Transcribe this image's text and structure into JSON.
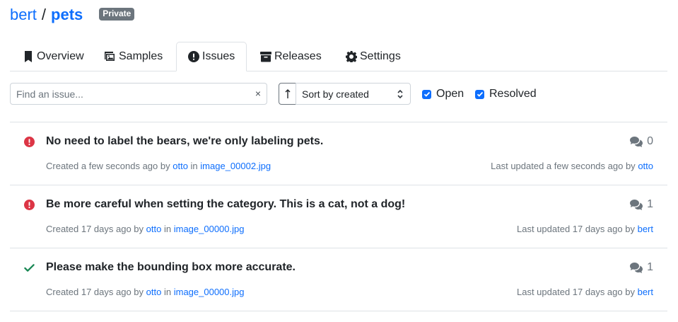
{
  "header": {
    "owner": "bert",
    "separator": "/",
    "repo": "pets",
    "visibility_badge": "Private"
  },
  "tabs": [
    {
      "label": "Overview",
      "icon": "bookmark-icon",
      "active": false
    },
    {
      "label": "Samples",
      "icon": "images-icon",
      "active": false
    },
    {
      "label": "Issues",
      "icon": "exclamation-circle-icon",
      "active": true
    },
    {
      "label": "Releases",
      "icon": "archive-icon",
      "active": false
    },
    {
      "label": "Settings",
      "icon": "gear-icon",
      "active": false
    }
  ],
  "filters": {
    "search_placeholder": "Find an issue...",
    "search_value": "",
    "clear": "×",
    "sort_label": "Sort by created",
    "open_label": "Open",
    "open_checked": true,
    "resolved_label": "Resolved",
    "resolved_checked": true
  },
  "issues": [
    {
      "status": "open",
      "title": "No need to label the bears, we're only labeling pets.",
      "comments": "0",
      "created_prefix": "Created a few seconds ago by",
      "author": "otto",
      "in": "in",
      "file": "image_00002.jpg",
      "updated_prefix": "Last updated a few seconds ago by",
      "updated_by": "otto"
    },
    {
      "status": "open",
      "title": "Be more careful when setting the category. This is a cat, not a dog!",
      "comments": "1",
      "created_prefix": "Created 17 days ago by",
      "author": "otto",
      "in": "in",
      "file": "image_00000.jpg",
      "updated_prefix": "Last updated 17 days ago by",
      "updated_by": "bert"
    },
    {
      "status": "resolved",
      "title": "Please make the bounding box more accurate.",
      "comments": "1",
      "created_prefix": "Created 17 days ago by",
      "author": "otto",
      "in": "in",
      "file": "image_00000.jpg",
      "updated_prefix": "Last updated 17 days ago by",
      "updated_by": "bert"
    }
  ],
  "colors": {
    "link": "#0d6efd",
    "open": "#dc3545",
    "resolved": "#198754",
    "muted": "#6c757d"
  }
}
